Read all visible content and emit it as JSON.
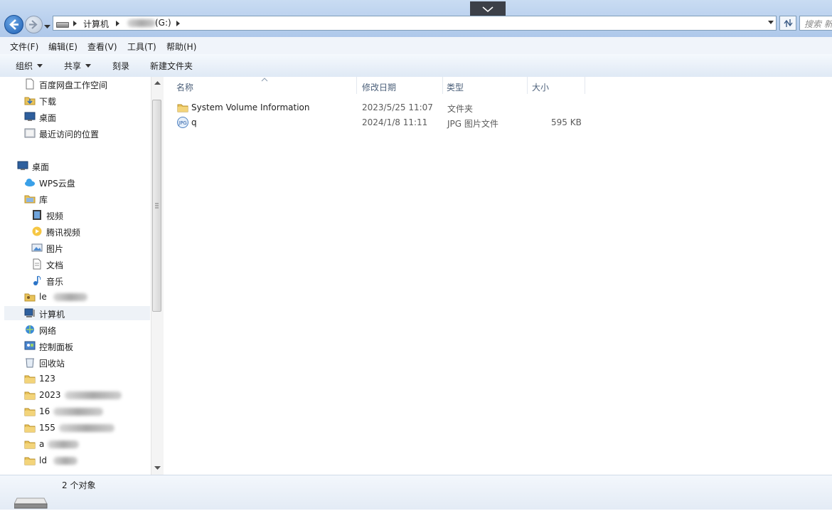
{
  "address_bar": {
    "crumbs": [
      "计算机",
      "(G:)"
    ],
    "search_placeholder": "搜索 新"
  },
  "menu": [
    "文件(F)",
    "编辑(E)",
    "查看(V)",
    "工具(T)",
    "帮助(H)"
  ],
  "toolbar": {
    "organize": "组织",
    "share": "共享",
    "burn": "刻录",
    "new_folder": "新建文件夹"
  },
  "nav": [
    {
      "label": "百度网盘工作空间",
      "icon": "document-icon"
    },
    {
      "label": "下载",
      "icon": "download-folder-icon"
    },
    {
      "label": "桌面",
      "icon": "desktop-icon"
    },
    {
      "label": "最近访问的位置",
      "icon": "recent-places-icon"
    },
    {
      "label": "桌面",
      "icon": "desktop-icon"
    },
    {
      "label": "WPS云盘",
      "icon": "cloud-icon"
    },
    {
      "label": "库",
      "icon": "library-icon"
    },
    {
      "label": "视频",
      "icon": "video-icon"
    },
    {
      "label": "腾讯视频",
      "icon": "tencent-video-icon"
    },
    {
      "label": "图片",
      "icon": "pictures-icon"
    },
    {
      "label": "文档",
      "icon": "documents-icon"
    },
    {
      "label": "音乐",
      "icon": "music-icon"
    },
    {
      "label": "le",
      "icon": "user-folder-icon"
    },
    {
      "label": "计算机",
      "icon": "computer-icon"
    },
    {
      "label": "网络",
      "icon": "network-icon"
    },
    {
      "label": "控制面板",
      "icon": "control-panel-icon"
    },
    {
      "label": "回收站",
      "icon": "recycle-bin-icon"
    },
    {
      "label": "123",
      "icon": "folder-icon"
    },
    {
      "label": "2023",
      "icon": "folder-icon"
    },
    {
      "label": "16",
      "icon": "folder-icon"
    },
    {
      "label": "155",
      "icon": "folder-icon"
    },
    {
      "label": "a",
      "icon": "folder-icon"
    },
    {
      "label": "ld",
      "icon": "folder-icon"
    }
  ],
  "columns": {
    "name": "名称",
    "date": "修改日期",
    "type": "类型",
    "size": "大小"
  },
  "files": [
    {
      "name": "System Volume Information",
      "date": "2023/5/25 11:07",
      "type": "文件夹",
      "size": "",
      "icon": "folder-icon"
    },
    {
      "name": "q",
      "date": "2024/1/8 11:11",
      "type": "JPG 图片文件",
      "size": "595 KB",
      "icon": "jpg-file-icon"
    }
  ],
  "status": {
    "count": "2 个对象"
  },
  "colors": {
    "accent": "#1e5fb3",
    "folder": "#e9c35a"
  }
}
